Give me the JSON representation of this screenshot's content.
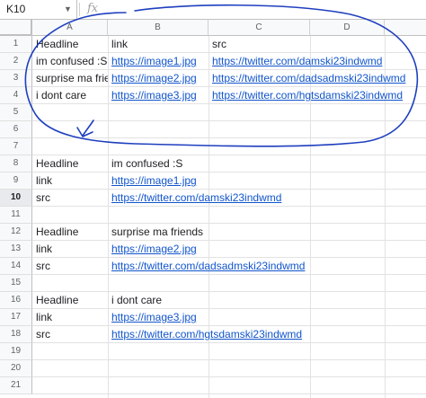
{
  "formula_bar": {
    "cell_ref": "K10",
    "fx_symbol": "fx",
    "formula": ""
  },
  "columns": [
    "A",
    "B",
    "C",
    "D"
  ],
  "rows": [
    "1",
    "2",
    "3",
    "4",
    "5",
    "6",
    "7",
    "8",
    "9",
    "10",
    "11",
    "12",
    "13",
    "14",
    "15",
    "16",
    "17",
    "18",
    "19",
    "20",
    "21"
  ],
  "selected_row": "10",
  "cells": {
    "r1": {
      "a": "Headline",
      "b": "link",
      "c": "src"
    },
    "r2": {
      "a": "im confused :S",
      "b": "https://image1.jpg",
      "c": "https://twitter.com/damski23indwmd"
    },
    "r3": {
      "a": "surprise ma friends",
      "b": "https://image2.jpg",
      "c": "https://twitter.com/dadsadmski23indwmd"
    },
    "r4": {
      "a": "i dont care",
      "b": "https://image3.jpg",
      "c": "https://twitter.com/hgtsdamski23indwmd"
    },
    "r8": {
      "a": "Headline",
      "b": "im confused :S"
    },
    "r9": {
      "a": "link",
      "b": "https://image1.jpg"
    },
    "r10": {
      "a": "src",
      "b": "https://twitter.com/damski23indwmd"
    },
    "r12": {
      "a": "Headline",
      "b": "surprise ma friends"
    },
    "r13": {
      "a": "link",
      "b": "https://image2.jpg"
    },
    "r14": {
      "a": "src",
      "b": "https://twitter.com/dadsadmski23indwmd"
    },
    "r16": {
      "a": "Headline",
      "b": "i dont care"
    },
    "r17": {
      "a": "link",
      "b": "https://image3.jpg"
    },
    "r18": {
      "a": "src",
      "b": "https://twitter.com/hgtsdamski23indwmd"
    }
  },
  "colors": {
    "link": "#1155cc",
    "scribble": "#1e3fbf",
    "header_bg": "#f8f9fa"
  }
}
